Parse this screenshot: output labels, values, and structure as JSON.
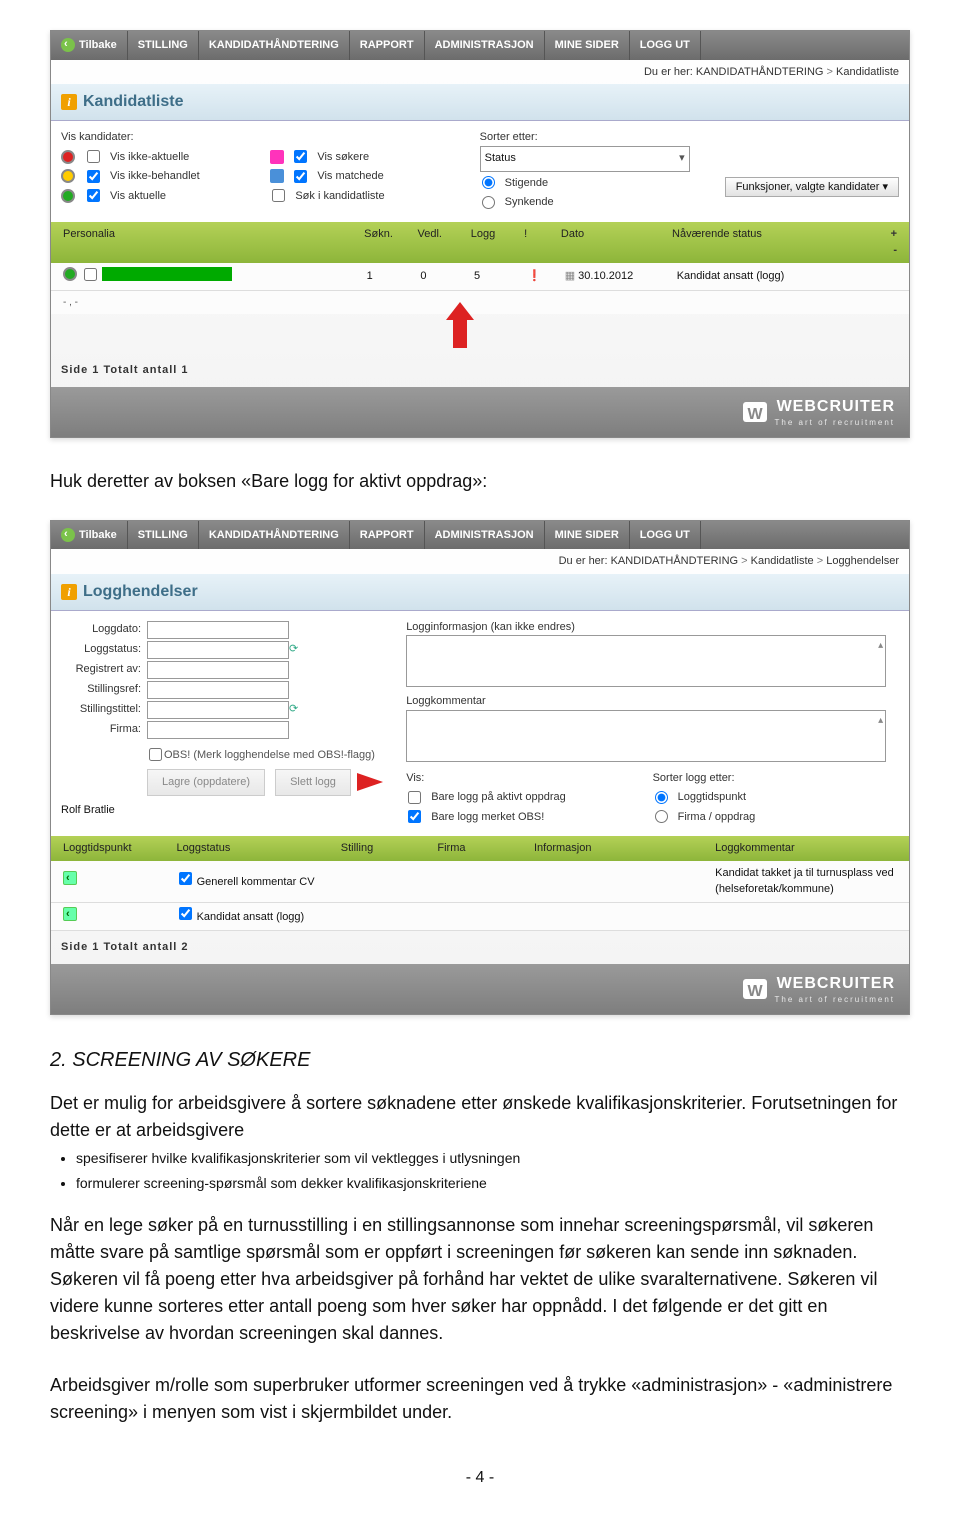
{
  "nav": [
    "Tilbake",
    "STILLING",
    "KANDIDATHÅNDTERING",
    "RAPPORT",
    "ADMINISTRASJON",
    "MINE SIDER",
    "LOGG UT"
  ],
  "breadcrumb1_prefix": "Du er her: ",
  "breadcrumb1_a": "KANDIDATHÅNDTERING",
  "breadcrumb1_b": "Kandidatliste",
  "breadcrumb2_prefix": "Du er her: ",
  "breadcrumb2_a": "KANDIDATHÅNDTERING",
  "breadcrumb2_b": "Kandidatliste",
  "breadcrumb2_c": "Logghendelser",
  "shot1": {
    "title": "Kandidatliste",
    "vis_kandidater": "Vis kandidater:",
    "vis_ikke_aktuelle": "Vis ikke-aktuelle",
    "vis_ikke_behandlet": "Vis ikke-behandlet",
    "vis_aktuelle": "Vis aktuelle",
    "vis_sokere": "Vis søkere",
    "vis_matchede": "Vis matchede",
    "sok_i": "Søk i kandidatliste",
    "sorter_etter": "Sorter etter:",
    "status": "Status",
    "stigende": "Stigende",
    "synkende": "Synkende",
    "funksjoner": "Funksjoner, valgte kandidater",
    "cols": {
      "personalia": "Personalia",
      "sokn": "Søkn.",
      "vedl": "Vedl.",
      "logg": "Logg",
      "ex": "!",
      "dato": "Dato",
      "status": "Nåværende status",
      "pm": "+ -"
    },
    "row": {
      "sokn": "1",
      "vedl": "0",
      "logg": "5",
      "dato": "30.10.2012",
      "status": "Kandidat ansatt (logg)"
    },
    "name_placeholder": "- , -",
    "footer": "Side 1 Totalt antall 1"
  },
  "text_huk": "Huk deretter av boksen «Bare logg for aktivt oppdrag»:",
  "shot2": {
    "title": "Logghendelser",
    "left": {
      "loggdato": "Loggdato:",
      "loggstatus": "Loggstatus:",
      "registrert": "Registrert av:",
      "stillingsref": "Stillingsref:",
      "stillingstittel": "Stillingstittel:",
      "firma": "Firma:",
      "obs": "OBS! (Merk logghendelse med OBS!-flagg)",
      "lagre": "Lagre (oppdatere)",
      "slett": "Slett logg",
      "user": "Rolf Bratlie"
    },
    "right": {
      "logginfo": "Logginformasjon (kan ikke endres)",
      "loggkommentar": "Loggkommentar",
      "vis": "Vis:",
      "bare_aktivt": "Bare logg på aktivt oppdrag",
      "bare_obs": "Bare logg merket OBS!",
      "sorter": "Sorter logg etter:",
      "loggtidspunkt": "Loggtidspunkt",
      "firma_oppdrag": "Firma / oppdrag"
    },
    "cols": {
      "loggtidspunkt": "Loggtidspunkt",
      "loggstatus": "Loggstatus",
      "stilling": "Stilling",
      "firma": "Firma",
      "informasjon": "Informasjon",
      "loggkommentar": "Loggkommentar"
    },
    "row1": {
      "status": "Generell kommentar CV",
      "komm": "Kandidat takket ja til turnusplass ved (helseforetak/kommune)"
    },
    "row2": {
      "status": "Kandidat ansatt (logg)"
    },
    "footer": "Side 1 Totalt antall 2"
  },
  "brand": "WEBCRUITER",
  "brand_sub": "The art of recruitment",
  "section2": "2. SCREENING AV SØKERE",
  "p1": "Det er mulig for arbeidsgivere å sortere søknadene etter ønskede kvalifikasjonskriterier. Forutsetningen for dette er at arbeidsgivere",
  "li1": "spesifiserer hvilke kvalifikasjonskriterier som vil vektlegges i utlysningen",
  "li2": "formulerer screening-spørsmål som dekker kvalifikasjonskriteriene",
  "p2": "Når en lege søker på en turnusstilling i en stillingsannonse som innehar screeningspørsmål, vil søkeren måtte svare på samtlige spørsmål som er oppført i screeningen før søkeren kan sende inn søknaden. Søkeren vil få poeng etter hva arbeidsgiver på forhånd har vektet de ulike svaralternativene. Søkeren vil videre kunne sorteres etter antall poeng som hver søker har oppnådd. I det følgende er det gitt en beskrivelse av hvordan screeningen skal dannes.",
  "p3": "Arbeidsgiver m/rolle som superbruker utformer screeningen ved å trykke «administrasjon» - «administrere screening» i menyen som vist i skjermbildet under.",
  "pagenum": "- 4 -"
}
